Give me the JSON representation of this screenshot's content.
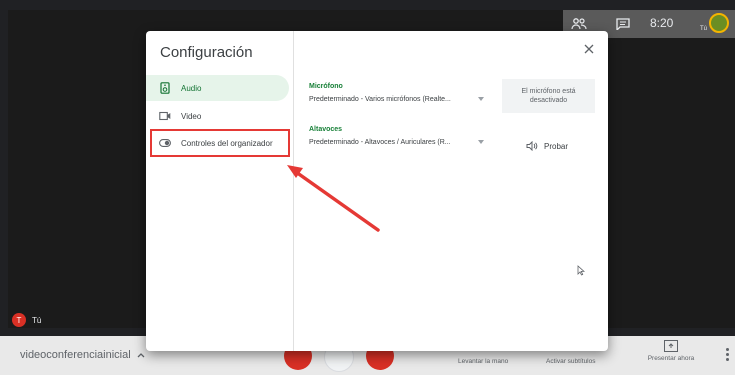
{
  "topbar": {
    "people_icon": "people-icon",
    "chat_icon": "chat-icon",
    "time": "8:20",
    "user_label": "Tú"
  },
  "self_tile": {
    "initial": "T",
    "name": "Tú"
  },
  "bottombar": {
    "meeting_name": "videoconferenciainicial",
    "raise_hand": "Levantar la mano",
    "captions": "Activar subtítulos",
    "present": "Presentar ahora"
  },
  "dialog": {
    "title": "Configuración",
    "nav": [
      {
        "label": "Audio",
        "icon": "speaker-device-icon",
        "active": true
      },
      {
        "label": "Video",
        "icon": "camera-icon",
        "active": false
      },
      {
        "label": "Controles del organizador",
        "icon": "toggle-icon",
        "active": false
      }
    ],
    "microphone": {
      "title": "Micrófono",
      "value": "Predeterminado - Varios micrófonos (Realte...",
      "status": "El micrófono está desactivado"
    },
    "speakers": {
      "title": "Altavoces",
      "value": "Predeterminado - Altavoces / Auriculares (R...",
      "test_label": "Probar"
    }
  },
  "colors": {
    "accent_green": "#188038",
    "active_bg": "#e6f4ea",
    "annotation_red": "#e53935"
  }
}
